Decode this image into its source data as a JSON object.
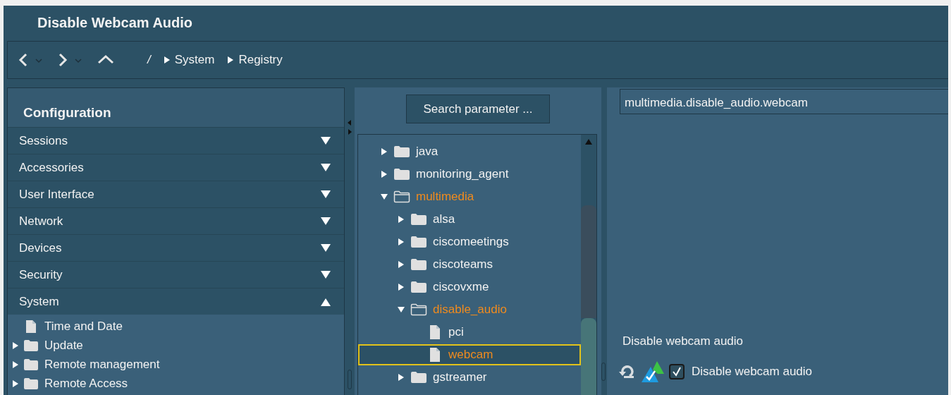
{
  "window": {
    "title": "Disable Webcam Audio"
  },
  "breadcrumb": {
    "root": "/",
    "items": [
      "System",
      "Registry"
    ]
  },
  "sidebar": {
    "title": "Configuration",
    "sections": [
      {
        "label": "Sessions",
        "expanded": false
      },
      {
        "label": "Accessories",
        "expanded": false
      },
      {
        "label": "User Interface",
        "expanded": false
      },
      {
        "label": "Network",
        "expanded": false
      },
      {
        "label": "Devices",
        "expanded": false
      },
      {
        "label": "Security",
        "expanded": false
      },
      {
        "label": "System",
        "expanded": true
      }
    ],
    "items": [
      {
        "label": "Time and Date",
        "kind": "file"
      },
      {
        "label": "Update",
        "kind": "folder",
        "expanded": false
      },
      {
        "label": "Remote management",
        "kind": "folder",
        "expanded": false
      },
      {
        "label": "Remote Access",
        "kind": "folder",
        "expanded": false
      }
    ]
  },
  "search_button": "Search parameter ...",
  "tree": [
    {
      "label": "java",
      "kind": "folder",
      "expanded": false,
      "selected": false
    },
    {
      "label": "monitoring_agent",
      "kind": "folder",
      "expanded": false,
      "selected": false
    },
    {
      "label": "multimedia",
      "kind": "folder",
      "expanded": true,
      "selected": false,
      "children": [
        {
          "label": "alsa",
          "kind": "folder",
          "expanded": false,
          "selected": false
        },
        {
          "label": "ciscomeetings",
          "kind": "folder",
          "expanded": false,
          "selected": false
        },
        {
          "label": "ciscoteams",
          "kind": "folder",
          "expanded": false,
          "selected": false
        },
        {
          "label": "ciscovxme",
          "kind": "folder",
          "expanded": false,
          "selected": false
        },
        {
          "label": "disable_audio",
          "kind": "folder",
          "expanded": true,
          "selected": false,
          "children": [
            {
              "label": "pci",
              "kind": "file",
              "selected": false
            },
            {
              "label": "webcam",
              "kind": "file",
              "selected": true
            }
          ]
        },
        {
          "label": "gstreamer",
          "kind": "folder",
          "expanded": false,
          "selected": false
        }
      ]
    }
  ],
  "path_field": {
    "value": "multimedia.disable_audio.webcam"
  },
  "parameter": {
    "description": "Disable webcam audio",
    "checkbox": {
      "label": "Disable webcam audio",
      "checked": true
    }
  }
}
